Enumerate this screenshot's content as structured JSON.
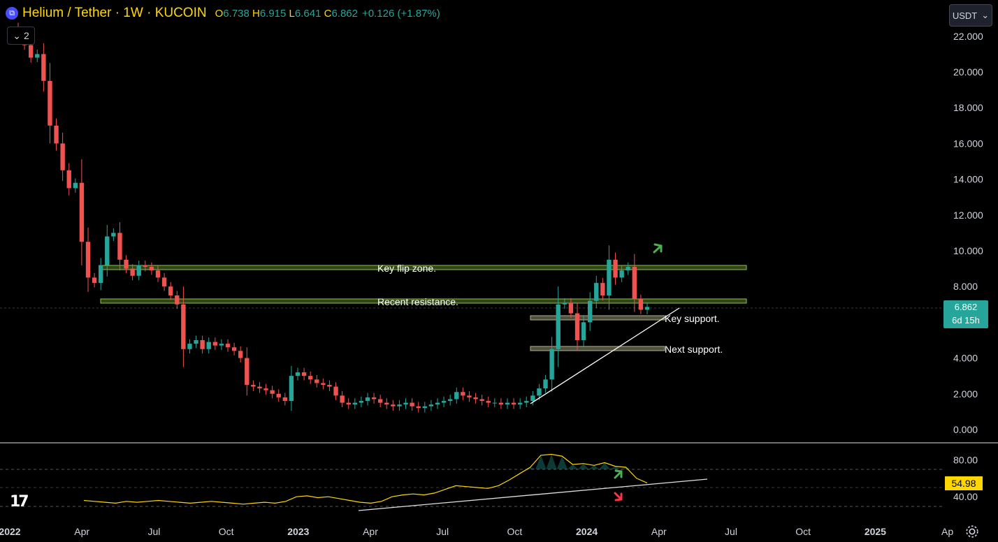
{
  "header": {
    "symbol_title": "Helium / Tether · 1W · KUCOIN",
    "open_label": "O",
    "open": "6.738",
    "high_label": "H",
    "high": "6.915",
    "low_label": "L",
    "low": "6.641",
    "close_label": "C",
    "close": "6.862",
    "change": "+0.126 (+1.87%)",
    "indicator_toggle_count": "2",
    "coin_icon": "helium-coin-icon"
  },
  "currency_selector": {
    "label": "USDT"
  },
  "price_axis": {
    "ticks": [
      "22.000",
      "20.000",
      "18.000",
      "16.000",
      "14.000",
      "12.000",
      "10.000",
      "8.000",
      "4.000",
      "2.000",
      "0.000"
    ],
    "current_price": "6.862",
    "countdown": "6d 15h"
  },
  "rsi_axis": {
    "ticks": [
      "80.00",
      "40.00"
    ],
    "current_value": "54.98"
  },
  "time_axis": {
    "labels": [
      "2022",
      "Apr",
      "Jul",
      "Oct",
      "2023",
      "Apr",
      "Jul",
      "Oct",
      "2024",
      "Apr",
      "Jul",
      "Oct",
      "2025",
      "Ap"
    ],
    "bold_years": [
      "2022",
      "2023",
      "2024",
      "2025"
    ]
  },
  "annotations": {
    "zone1": "Key flip zone.",
    "zone2": "Recent resistance.",
    "zone3": "Key support.",
    "zone4": "Next support."
  },
  "colors": {
    "up": "#26a69a",
    "down": "#ef5350",
    "accent_yellow": "#ffd700",
    "zone_green": "#8bc34a",
    "zone_gray": "#9e9e7a",
    "arrow_green": "#4caf50",
    "arrow_red": "#f23645"
  },
  "chart_data": {
    "type": "candlestick",
    "title": "Helium / Tether · 1W · KUCOIN",
    "ylim": [
      0,
      23
    ],
    "x_range": [
      "2022-01",
      "2025-04"
    ],
    "key_flip_zone": [
      9.0,
      9.2
    ],
    "recent_resistance": [
      7.1,
      7.3
    ],
    "key_support": [
      6.3,
      6.6
    ],
    "next_support": [
      4.5,
      4.7
    ],
    "weekly_closes_approx": [
      22.0,
      21.5,
      20.8,
      21.0,
      19.5,
      17.0,
      16.0,
      14.5,
      13.5,
      13.8,
      10.5,
      8.5,
      8.2,
      9.2,
      10.8,
      11.0,
      9.5,
      9.0,
      8.6,
      9.2,
      9.1,
      8.9,
      8.5,
      8.0,
      7.5,
      7.0,
      4.5,
      4.8,
      5.0,
      4.5,
      4.9,
      4.7,
      4.8,
      4.6,
      4.4,
      4.0,
      2.5,
      2.4,
      2.3,
      2.2,
      2.0,
      1.8,
      1.6,
      3.0,
      3.2,
      3.0,
      2.8,
      2.6,
      2.5,
      2.4,
      1.9,
      1.5,
      1.4,
      1.5,
      1.6,
      1.8,
      1.7,
      1.5,
      1.4,
      1.3,
      1.4,
      1.5,
      1.3,
      1.2,
      1.3,
      1.4,
      1.5,
      1.6,
      1.7,
      2.1,
      1.9,
      1.8,
      1.7,
      1.6,
      1.5,
      1.5,
      1.4,
      1.5,
      1.4,
      1.5,
      1.6,
      1.9,
      2.3,
      2.8,
      4.5,
      7.0,
      7.1,
      6.5,
      5.0,
      6.0,
      7.2,
      8.2,
      7.5,
      9.5,
      8.5,
      8.9,
      9.1,
      7.3,
      6.7,
      6.86
    ],
    "rsi": {
      "name": "RSI",
      "upper_band": 70,
      "lower_band": 30,
      "values_approx": [
        36,
        35,
        34,
        33,
        35,
        34,
        35,
        36,
        35,
        34,
        33,
        34,
        35,
        34,
        33,
        32,
        33,
        34,
        33,
        35,
        40,
        41,
        39,
        40,
        38,
        36,
        34,
        33,
        35,
        40,
        42,
        43,
        42,
        44,
        48,
        52,
        51,
        50,
        49,
        52,
        58,
        65,
        72,
        85,
        86,
        84,
        75,
        76,
        74,
        77,
        73,
        72,
        60,
        55
      ]
    }
  }
}
